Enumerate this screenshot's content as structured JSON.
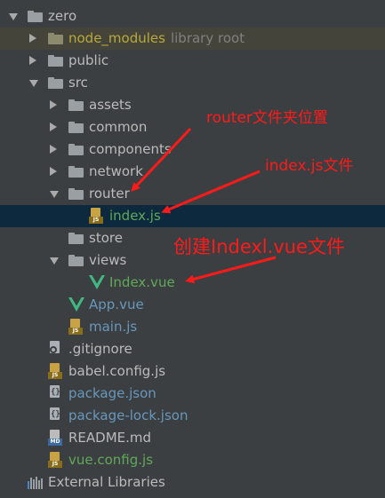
{
  "tree": {
    "rows": [
      {
        "label": "zero",
        "extra": "",
        "indent": 0,
        "arrow": "open",
        "icon": "folder-icon",
        "color": "normal"
      },
      {
        "label": "node_modules",
        "extra": "library root",
        "indent": 1,
        "arrow": "closed",
        "icon": "library-folder-icon",
        "color": "lib"
      },
      {
        "label": "public",
        "extra": "",
        "indent": 1,
        "arrow": "closed",
        "icon": "folder-icon",
        "color": "normal"
      },
      {
        "label": "src",
        "extra": "",
        "indent": 1,
        "arrow": "open",
        "icon": "folder-icon",
        "color": "normal"
      },
      {
        "label": "assets",
        "extra": "",
        "indent": 2,
        "arrow": "closed",
        "icon": "folder-icon",
        "color": "normal"
      },
      {
        "label": "common",
        "extra": "",
        "indent": 2,
        "arrow": "closed",
        "icon": "folder-icon",
        "color": "normal"
      },
      {
        "label": "components",
        "extra": "",
        "indent": 2,
        "arrow": "closed",
        "icon": "folder-icon",
        "color": "normal"
      },
      {
        "label": "network",
        "extra": "",
        "indent": 2,
        "arrow": "closed",
        "icon": "folder-icon",
        "color": "normal"
      },
      {
        "label": "router",
        "extra": "",
        "indent": 2,
        "arrow": "open",
        "icon": "folder-icon",
        "color": "normal"
      },
      {
        "label": "index.js",
        "extra": "",
        "indent": 3,
        "arrow": "none",
        "icon": "js-file-icon",
        "color": "green"
      },
      {
        "label": "store",
        "extra": "",
        "indent": 2,
        "arrow": "none",
        "icon": "folder-icon",
        "color": "normal"
      },
      {
        "label": "views",
        "extra": "",
        "indent": 2,
        "arrow": "open",
        "icon": "folder-icon",
        "color": "normal"
      },
      {
        "label": "Index.vue",
        "extra": "",
        "indent": 3,
        "arrow": "none",
        "icon": "vue-icon",
        "color": "green"
      },
      {
        "label": "App.vue",
        "extra": "",
        "indent": 2,
        "arrow": "none",
        "icon": "vue-icon",
        "color": "blue"
      },
      {
        "label": "main.js",
        "extra": "",
        "indent": 2,
        "arrow": "none",
        "icon": "js-file-icon",
        "color": "blue"
      },
      {
        "label": ".gitignore",
        "extra": "",
        "indent": 1,
        "arrow": "none",
        "icon": "gitignore-file-icon",
        "color": "normal"
      },
      {
        "label": "babel.config.js",
        "extra": "",
        "indent": 1,
        "arrow": "none",
        "icon": "js-file-icon",
        "color": "normal"
      },
      {
        "label": "package.json",
        "extra": "",
        "indent": 1,
        "arrow": "none",
        "icon": "json-file-icon",
        "color": "blue"
      },
      {
        "label": "package-lock.json",
        "extra": "",
        "indent": 1,
        "arrow": "none",
        "icon": "json-file-icon",
        "color": "blue"
      },
      {
        "label": "README.md",
        "extra": "",
        "indent": 1,
        "arrow": "none",
        "icon": "md-file-icon",
        "color": "normal"
      },
      {
        "label": "vue.config.js",
        "extra": "",
        "indent": 1,
        "arrow": "none",
        "icon": "js-file-icon",
        "color": "green"
      },
      {
        "label": "External Libraries",
        "extra": "",
        "indent": 0,
        "arrow": "none",
        "icon": "external-libraries-icon",
        "color": "normal"
      }
    ],
    "selected_index": 9,
    "library_index": 1
  },
  "annotations": {
    "router_folder": "router文件夹位置",
    "index_js": "index.js文件",
    "create_vue": "创建Indexl.vue文件"
  },
  "colors": {
    "background": "#3c3f41",
    "selected_row": "#0d293e",
    "library_row": "#45443a",
    "text_normal": "#bbbbbb",
    "text_library": "#b8a93a",
    "text_green": "#62a85a",
    "text_blue": "#6897bb",
    "annotation_red": "#ff1a1a",
    "vue_green": "#41b883"
  }
}
